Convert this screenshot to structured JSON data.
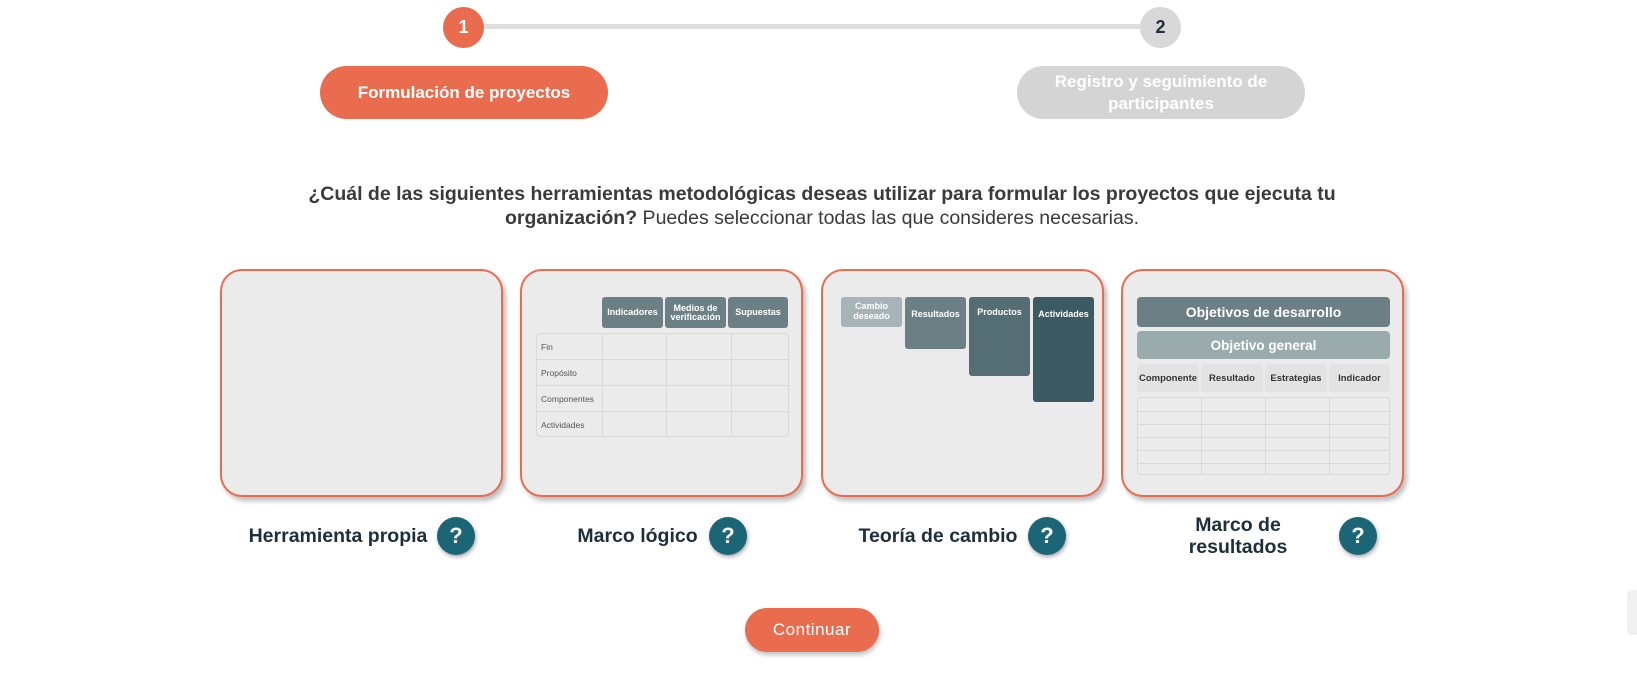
{
  "stepper": {
    "steps": [
      {
        "number": "1",
        "label": "Formulación de proyectos",
        "state": "active"
      },
      {
        "number": "2",
        "label": "Registro y seguimiento de participantes",
        "state": "inactive"
      }
    ]
  },
  "question": {
    "bold": "¿Cuál de las siguientes herramientas metodológicas deseas utilizar para formular los proyectos que ejecuta tu organización?",
    "normal": " Puedes seleccionar todas las que consideres necesarias."
  },
  "tools": [
    {
      "title": "Herramienta propia",
      "help": "?"
    },
    {
      "title": "Marco lógico",
      "help": "?"
    },
    {
      "title": "Teoría de cambio",
      "help": "?"
    },
    {
      "title": "Marco de resultados",
      "help": "?"
    }
  ],
  "marco_logico_preview": {
    "headers": [
      "Indicadores",
      "Medios de verificación",
      "Supuestas"
    ],
    "rows": [
      "Fin",
      "Propósito",
      "Componentes",
      "Actividades"
    ]
  },
  "teoria_cambio_preview": {
    "boxes": [
      "Cambio deseado",
      "Resultados",
      "Productos",
      "Actividades"
    ]
  },
  "marco_resultados_preview": {
    "band1": "Objetivos de desarrollo",
    "band2": "Objetivo general",
    "columns": [
      "Componente",
      "Resultado",
      "Estrategias",
      "Indicador"
    ]
  },
  "continue_label": "Continuar",
  "colors": {
    "accent": "#e96c4f",
    "help": "#1c6577",
    "inactive": "#d4d4d4"
  }
}
